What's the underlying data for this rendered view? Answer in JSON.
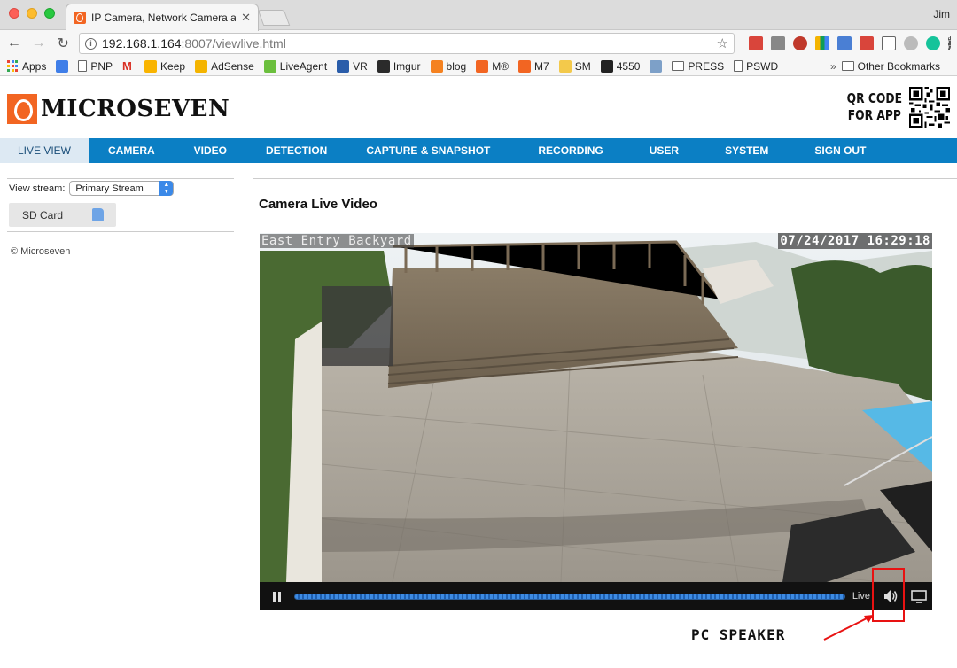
{
  "browser": {
    "tab_title": "IP Camera, Network Camera ar",
    "user": "Jim",
    "url_host": "192.168.1.164",
    "url_rest": ":8007/viewlive.html"
  },
  "bookmarks": [
    {
      "label": "Apps",
      "icon": "apps-grid-icon"
    },
    {
      "label": "",
      "icon": "calendar-icon"
    },
    {
      "label": "PNP",
      "icon": "document-icon"
    },
    {
      "label": "",
      "icon": "gmail-icon"
    },
    {
      "label": "Keep",
      "icon": "keep-icon"
    },
    {
      "label": "AdSense",
      "icon": "adsense-icon"
    },
    {
      "label": "LiveAgent",
      "icon": "liveagent-icon"
    },
    {
      "label": "VR",
      "icon": "vr-icon"
    },
    {
      "label": "Imgur",
      "icon": "imgur-icon"
    },
    {
      "label": "blog",
      "icon": "blog-icon"
    },
    {
      "label": "M®",
      "icon": "microseven-icon"
    },
    {
      "label": "M7",
      "icon": "microseven-icon"
    },
    {
      "label": "SM",
      "icon": "mail-icon"
    },
    {
      "label": "4550",
      "icon": "q-icon"
    },
    {
      "label": "",
      "icon": "play-store-icon"
    },
    {
      "label": "PRESS",
      "icon": "folder-icon"
    },
    {
      "label": "PSWD",
      "icon": "document-icon"
    }
  ],
  "bookmarks_more": "»",
  "other_bookmarks": "Other Bookmarks",
  "brand": {
    "name": "MICROSEVEN",
    "qr_line1": "QR CODE",
    "qr_line2": "FOR APP"
  },
  "nav": [
    {
      "label": "LIVE VIEW",
      "active": true
    },
    {
      "label": "CAMERA"
    },
    {
      "label": "VIDEO"
    },
    {
      "label": "DETECTION"
    },
    {
      "label": "CAPTURE & SNAPSHOT"
    },
    {
      "label": "RECORDING"
    },
    {
      "label": "USER"
    },
    {
      "label": "SYSTEM"
    },
    {
      "label": "SIGN OUT"
    }
  ],
  "sidebar": {
    "view_stream_label": "View stream:",
    "stream_selected": "Primary Stream",
    "sd_card_label": "SD Card",
    "copyright": "© Microseven"
  },
  "main": {
    "title": "Camera Live Video",
    "osd_name": "East Entry Backyard",
    "osd_timestamp": "07/24/2017 16:29:18",
    "live_label": "Live"
  },
  "annotation": {
    "text": "PC SPEAKER",
    "color": "#e81212"
  },
  "colors": {
    "nav_bar": "#0b7fc4",
    "brand_orange": "#f26522"
  }
}
